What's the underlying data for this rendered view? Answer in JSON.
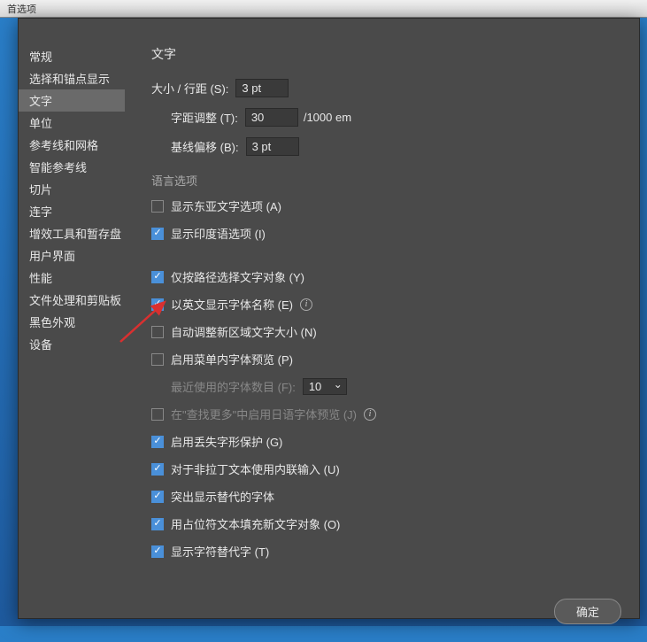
{
  "window": {
    "title": "首选项"
  },
  "sidebar": {
    "items": [
      {
        "label": "常规",
        "selected": false
      },
      {
        "label": "选择和锚点显示",
        "selected": false
      },
      {
        "label": "文字",
        "selected": true
      },
      {
        "label": "单位",
        "selected": false
      },
      {
        "label": "参考线和网格",
        "selected": false
      },
      {
        "label": "智能参考线",
        "selected": false
      },
      {
        "label": "切片",
        "selected": false
      },
      {
        "label": "连字",
        "selected": false
      },
      {
        "label": "增效工具和暂存盘",
        "selected": false
      },
      {
        "label": "用户界面",
        "selected": false
      },
      {
        "label": "性能",
        "selected": false
      },
      {
        "label": "文件处理和剪贴板",
        "selected": false
      },
      {
        "label": "黑色外观",
        "selected": false
      },
      {
        "label": "设备",
        "selected": false
      }
    ]
  },
  "content": {
    "title": "文字",
    "fields": {
      "size_leading": {
        "label": "大小 / 行距 (S):",
        "value": "3 pt"
      },
      "tracking": {
        "label": "字距调整 (T):",
        "value": "30",
        "suffix": "/1000 em"
      },
      "baseline": {
        "label": "基线偏移 (B):",
        "value": "3 pt"
      }
    },
    "lang_section": {
      "title": "语言选项",
      "items": [
        {
          "label": "显示东亚文字选项 (A)",
          "checked": false
        },
        {
          "label": "显示印度语选项 (I)",
          "checked": true
        }
      ]
    },
    "options": [
      {
        "label": "仅按路径选择文字对象 (Y)",
        "checked": true,
        "info": false
      },
      {
        "label": "以英文显示字体名称 (E)",
        "checked": true,
        "info": true
      },
      {
        "label": "自动调整新区域文字大小 (N)",
        "checked": false,
        "info": false,
        "arrow": true
      },
      {
        "label": "启用菜单内字体预览 (P)",
        "checked": false,
        "info": false
      }
    ],
    "recent_fonts": {
      "label": "最近使用的字体数目 (F):",
      "value": "10"
    },
    "options2": [
      {
        "label": "在\"查找更多\"中启用日语字体预览 (J)",
        "checked": false,
        "info": true,
        "disabled": true
      },
      {
        "label": "启用丢失字形保护 (G)",
        "checked": true
      },
      {
        "label": "对于非拉丁文本使用内联输入 (U)",
        "checked": true
      },
      {
        "label": "突出显示替代的字体",
        "checked": true
      },
      {
        "label": "用占位符文本填充新文字对象 (O)",
        "checked": true
      },
      {
        "label": "显示字符替代字 (T)",
        "checked": true
      }
    ]
  },
  "footer": {
    "ok": "确定"
  }
}
